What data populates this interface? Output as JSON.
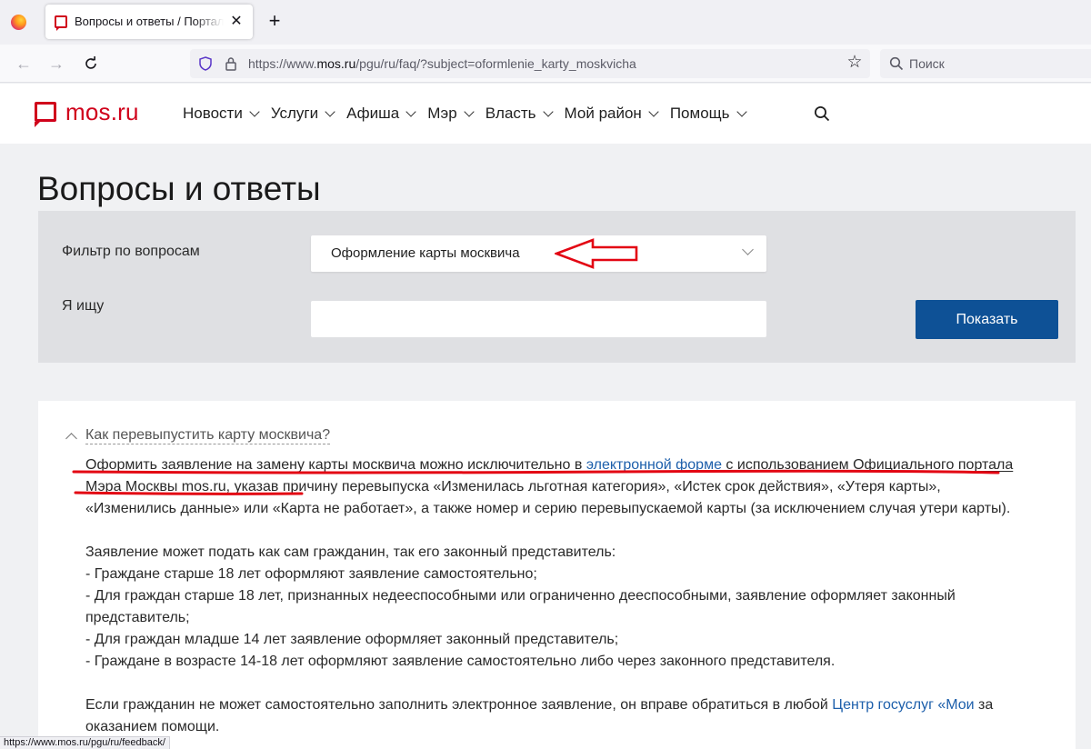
{
  "browser": {
    "tab_title": "Вопросы и ответы / Портал го",
    "tab_close": "✕",
    "new_tab": "+",
    "url_prefix": "https://www.",
    "url_host": "mos.ru",
    "url_path": "/pgu/ru/faq/?subject=oformlenie_karty_moskvicha",
    "search_placeholder": "Поиск",
    "status_url": "https://www.mos.ru/pgu/ru/feedback/"
  },
  "site": {
    "logo": "mos.ru",
    "menu": [
      "Новости",
      "Услуги",
      "Афиша",
      "Мэр",
      "Власть",
      "Мой район",
      "Помощь"
    ]
  },
  "page": {
    "title": "Вопросы и ответы",
    "filter_label": "Фильтр по вопросам",
    "filter_value": "Оформление карты москвича",
    "search_label": "Я ищу",
    "search_value": "",
    "show_button": "Показать"
  },
  "faq": {
    "question": "Как перевыпустить карту москвича?",
    "p1_part1": "Оформить заявление на замену карты москвича можно исключительно в ",
    "p1_link": "электронной форме",
    "p1_part2": " с использованием Официального ",
    "p1_part3": "портала Мэра Москвы mos.ru",
    "p1_part4": ", указав причину перевыпуска «Изменилась льготная категория», «Истек срок действия», «Утеря карты», «Изменились данные» или «Карта не работает», а также номер и серию перевыпускаемой карты (за исключением случая утери карты).",
    "p2_lines": [
      "Заявление может подать как сам гражданин, так его законный представитель:",
      "- Граждане старше 18 лет оформляют заявление самостоятельно;",
      "- Для граждан старше 18 лет, признанных недееспособными или ограниченно дееспособными, заявление оформляет законный представитель;",
      "- Для граждан младше 14 лет заявление оформляет законный представитель;",
      "- Граждане в возрасте 14-18 лет оформляют заявление самостоятельно либо через законного представителя."
    ],
    "p3_part1": "Если гражданин не может самостоятельно заполнить электронное заявление, он вправе обратиться в любой ",
    "p3_link": "Центр госуслуг «Мои",
    "p3_part2": " за оказанием помощи."
  },
  "colors": {
    "brand_red": "#d0021b",
    "button_blue": "#0e5196",
    "link_blue": "#1d5fab",
    "annotation_red": "#e30613"
  }
}
